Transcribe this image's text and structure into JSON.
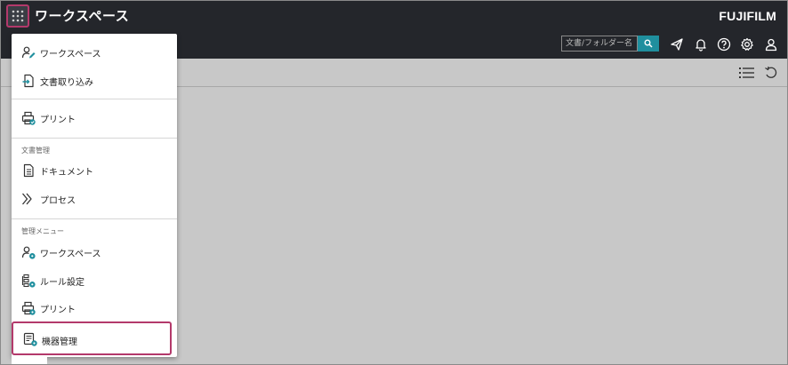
{
  "header": {
    "title": "ワークスペース",
    "brand": "FUJIFILM",
    "search_placeholder": "文書/フォルダー名"
  },
  "menu": {
    "items_top": [
      {
        "label": "ワークスペース",
        "icon": "user-edit-icon"
      },
      {
        "label": "文書取り込み",
        "icon": "document-import-icon"
      }
    ],
    "print": {
      "label": "プリント",
      "icon": "printer-check-icon"
    },
    "section_document": "文書管理",
    "document_items": [
      {
        "label": "ドキュメント",
        "icon": "document-icon"
      },
      {
        "label": "プロセス",
        "icon": "process-chevron-icon"
      }
    ],
    "section_admin": "管理メニュー",
    "admin_items": [
      {
        "label": "ワークスペース",
        "icon": "user-settings-icon"
      },
      {
        "label": "ルール設定",
        "icon": "rule-settings-icon"
      },
      {
        "label": "プリント",
        "icon": "printer-settings-icon"
      },
      {
        "label": "機器管理",
        "icon": "device-settings-icon"
      }
    ]
  },
  "colors": {
    "header_bg": "#24262b",
    "accent_teal": "#1f8f9e",
    "highlight_border": "#b3396b",
    "content_bg": "#c8c8c8"
  }
}
